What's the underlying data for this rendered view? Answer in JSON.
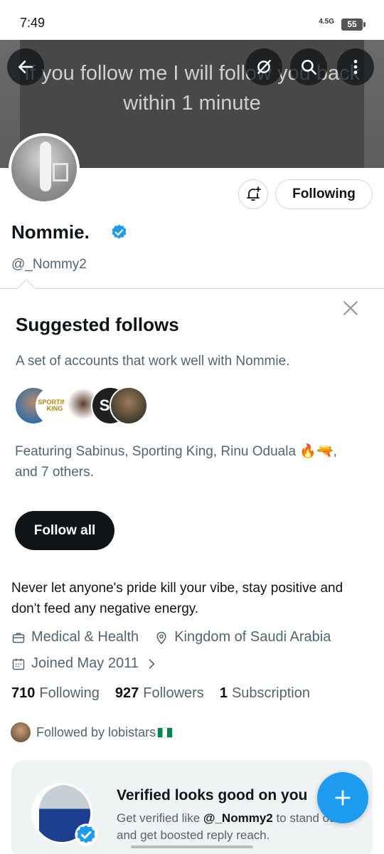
{
  "status_bar": {
    "time": "7:49",
    "network": "4.5G",
    "battery": "55"
  },
  "banner": {
    "text": "If you follow me I will follow you back within 1 minute"
  },
  "profile": {
    "display_name": "Nommie.",
    "handle": "@_Nommy2",
    "following_button": "Following",
    "bio": "Never let anyone's pride kill your vibe, stay positive and don't feed any negative energy.",
    "category": "Medical & Health",
    "location": "Kingdom of Saudi Arabia",
    "joined": "Joined May 2011",
    "stats": {
      "following_count": "710",
      "following_label": "Following",
      "followers_count": "927",
      "followers_label": "Followers",
      "subscription_count": "1",
      "subscription_label": "Subscription"
    },
    "followed_by": "Followed by lobistars"
  },
  "suggested": {
    "title": "Suggested follows",
    "description": "A set of accounts that work well with Nommie.",
    "featuring": "Featuring Sabinus, Sporting King, Rinu Oduala 🔥🔫, and 7 others.",
    "follow_all": "Follow all",
    "avatar_labels": {
      "sporting_king": "SPORTING KING",
      "sr": "SR"
    }
  },
  "promo": {
    "title": "Verified looks good on you",
    "text_prefix": "Get verified like ",
    "text_handle": "@_Nommy2",
    "text_suffix": " to stand out and get boosted reply reach."
  },
  "colors": {
    "accent": "#1d9bf0",
    "text": "#0f1419",
    "secondary": "#536471"
  },
  "icons": [
    "back-arrow-icon",
    "grok-icon",
    "search-icon",
    "more-icon",
    "bell-plus-icon",
    "verified-icon",
    "close-icon",
    "briefcase-icon",
    "location-icon",
    "calendar-icon",
    "chevron-right-icon",
    "plus-icon"
  ]
}
